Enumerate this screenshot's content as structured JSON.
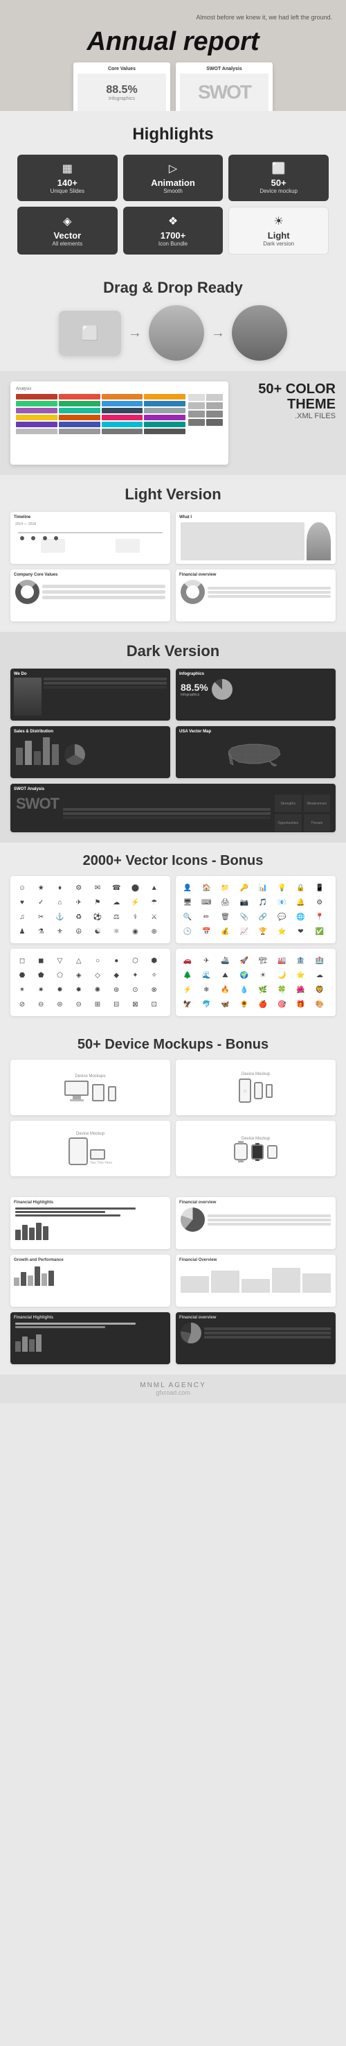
{
  "hero": {
    "title": "Annual report",
    "subtitle": "Almost before we knew it, we had\nleft the ground."
  },
  "highlights": {
    "section_title": "Highlights",
    "badges": [
      {
        "icon": "▦",
        "number": "140+",
        "label": "Unique Slides"
      },
      {
        "icon": "▷",
        "number": "Animation",
        "label": "Smooth"
      },
      {
        "icon": "⬜",
        "number": "50+",
        "label": "Device mockup"
      },
      {
        "icon": "◈",
        "number": "Vector",
        "label": "All elements"
      },
      {
        "icon": "❖",
        "number": "1700+",
        "label": "Icon Bundle"
      },
      {
        "icon": "☀",
        "number": "Light",
        "label": "Dark version",
        "style": "light"
      }
    ]
  },
  "drag_drop": {
    "title": "Drag & Drop Ready"
  },
  "color_theme": {
    "title": "50+ COLOR THEME",
    "subtitle": ".XML FILES"
  },
  "light_version": {
    "title": "Light Version",
    "slides": [
      {
        "label": "Timeline"
      },
      {
        "label": "What I"
      },
      {
        "label": "Company Core Values"
      },
      {
        "label": "Financial overview"
      }
    ]
  },
  "dark_version": {
    "title": "Dark Version",
    "slides": [
      {
        "label": "We Do"
      },
      {
        "label": "Infographics"
      },
      {
        "label": "Sales & Distribution"
      },
      {
        "label": "USA Vector Map"
      },
      {
        "label": "SWOT Analysis"
      }
    ]
  },
  "icons_bonus": {
    "title": "2000+ Vector Icons - Bonus"
  },
  "mockups_bonus": {
    "title": "50+ Device Mockups - Bonus"
  },
  "financial": {
    "slides": [
      {
        "label": "Financial Highlights",
        "dark": false
      },
      {
        "label": "Financial overview",
        "dark": false
      },
      {
        "label": "Growth and Performance",
        "dark": false
      },
      {
        "label": "Financial Overview",
        "dark": false
      },
      {
        "label": "Financial Highlights",
        "dark": true
      },
      {
        "label": "Financial overview",
        "dark": true
      }
    ]
  },
  "footer": {
    "agency": "MNML AGENCY",
    "url": "gfxroad.com"
  },
  "colors": {
    "swatches": [
      "#c0392b",
      "#e74c3c",
      "#e67e22",
      "#f39c12",
      "#2ecc71",
      "#27ae60",
      "#3498db",
      "#2980b9",
      "#9b59b6",
      "#8e44ad",
      "#1abc9c",
      "#16a085",
      "#34495e",
      "#2c3e50",
      "#95a5a6",
      "#7f8c8d",
      "#f1c40f",
      "#d35400",
      "#e91e63",
      "#9c27b0",
      "#673ab7",
      "#3f51b5",
      "#00bcd4",
      "#009688"
    ]
  },
  "icons_list": [
    "☺",
    "★",
    "♦",
    "⚙",
    "✉",
    "☎",
    "⬤",
    "▲",
    "◆",
    "♥",
    "✓",
    "✗",
    "⌂",
    "✈",
    "⚑",
    "☁",
    "⚡",
    "☂",
    "♫",
    "✂",
    "⚓",
    "♻",
    "⚽",
    "⚖",
    "⚕",
    "⚔",
    "♟",
    "⚗",
    "⚜",
    "☮",
    "☯",
    "⚛",
    "⬡",
    "⬢",
    "⬣",
    "⬟",
    "⬠",
    "⬞",
    "◉",
    "⊛",
    "⊙",
    "⊕",
    "⊗",
    "⊘",
    "⊖",
    "⊜",
    "⊝",
    "⊞"
  ]
}
